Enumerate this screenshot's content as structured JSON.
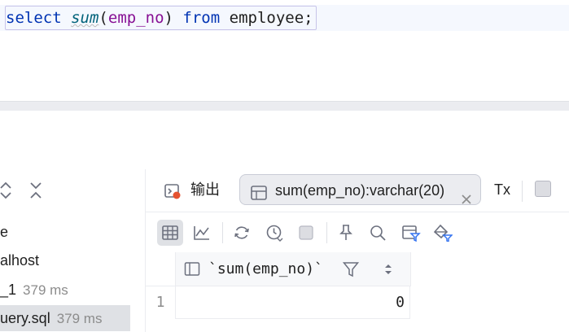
{
  "editor": {
    "code_tokens": {
      "select": "select",
      "sum": "sum",
      "paren_open": "(",
      "column": "emp_no",
      "paren_close": ")",
      "from": "from",
      "table": "employee",
      "semicolon": ";"
    }
  },
  "left_panel": {
    "items": [
      {
        "label": "e",
        "meta": ""
      },
      {
        "label": "alhost",
        "meta": ""
      },
      {
        "label": "_1",
        "meta": "379 ms"
      },
      {
        "label": "uery.sql",
        "meta": "379 ms"
      }
    ]
  },
  "result_tabs": {
    "output_label": "输出",
    "result_label": "sum(emp_no):varchar(20)",
    "tx_label": "Tx"
  },
  "grid": {
    "column_header": "`sum(emp_no)`",
    "rows": [
      {
        "row_number": "1",
        "value": "0"
      }
    ]
  },
  "colors": {
    "keyword": "#0033b3",
    "function": "#00627a",
    "identifier": "#871094",
    "selection": "#dfe1e5"
  }
}
